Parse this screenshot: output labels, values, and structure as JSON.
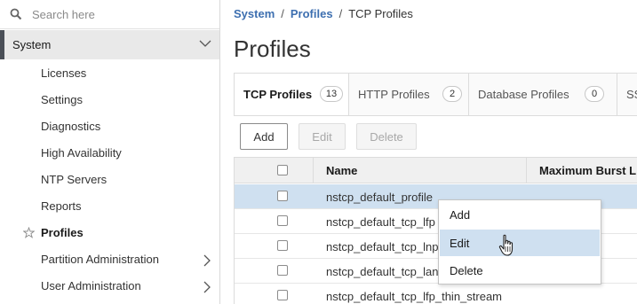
{
  "search": {
    "placeholder": "Search here"
  },
  "sidebar": {
    "section": "System",
    "items": [
      {
        "label": "Licenses"
      },
      {
        "label": "Settings"
      },
      {
        "label": "Diagnostics"
      },
      {
        "label": "High Availability"
      },
      {
        "label": "NTP Servers"
      },
      {
        "label": "Reports"
      },
      {
        "label": "Profiles",
        "active": true,
        "favorite": true
      },
      {
        "label": "Partition Administration",
        "expandable": true
      },
      {
        "label": "User Administration",
        "expandable": true
      }
    ]
  },
  "breadcrumb": {
    "items": [
      "System",
      "Profiles",
      "TCP Profiles"
    ],
    "separator": "/"
  },
  "page": {
    "title": "Profiles"
  },
  "tabs": [
    {
      "label": "TCP Profiles",
      "count": "13",
      "active": true
    },
    {
      "label": "HTTP Profiles",
      "count": "2"
    },
    {
      "label": "Database Profiles",
      "count": "0"
    },
    {
      "label": "SS"
    }
  ],
  "toolbar": {
    "add_label": "Add",
    "edit_label": "Edit",
    "delete_label": "Delete"
  },
  "table": {
    "columns": [
      "Name",
      "Maximum Burst Lin"
    ],
    "rows": [
      {
        "name": "nstcp_default_profile",
        "selected": true
      },
      {
        "name": "nstcp_default_tcp_lfp"
      },
      {
        "name": "nstcp_default_tcp_lnp"
      },
      {
        "name": "nstcp_default_tcp_lan"
      },
      {
        "name": "nstcp_default_tcp_lfp_thin_stream"
      }
    ]
  },
  "context_menu": {
    "items": [
      "Add",
      "Edit",
      "Delete"
    ],
    "highlighted": "Edit"
  },
  "colors": {
    "link": "#3d6fb0",
    "selected_row": "#cfe0f0",
    "sidebar_accent": "#4a4f57",
    "section_bg": "#e9e9e9"
  },
  "icons": [
    "search-icon",
    "chevron-down-icon",
    "star-icon",
    "chevron-right-icon",
    "hand-cursor-icon"
  ]
}
